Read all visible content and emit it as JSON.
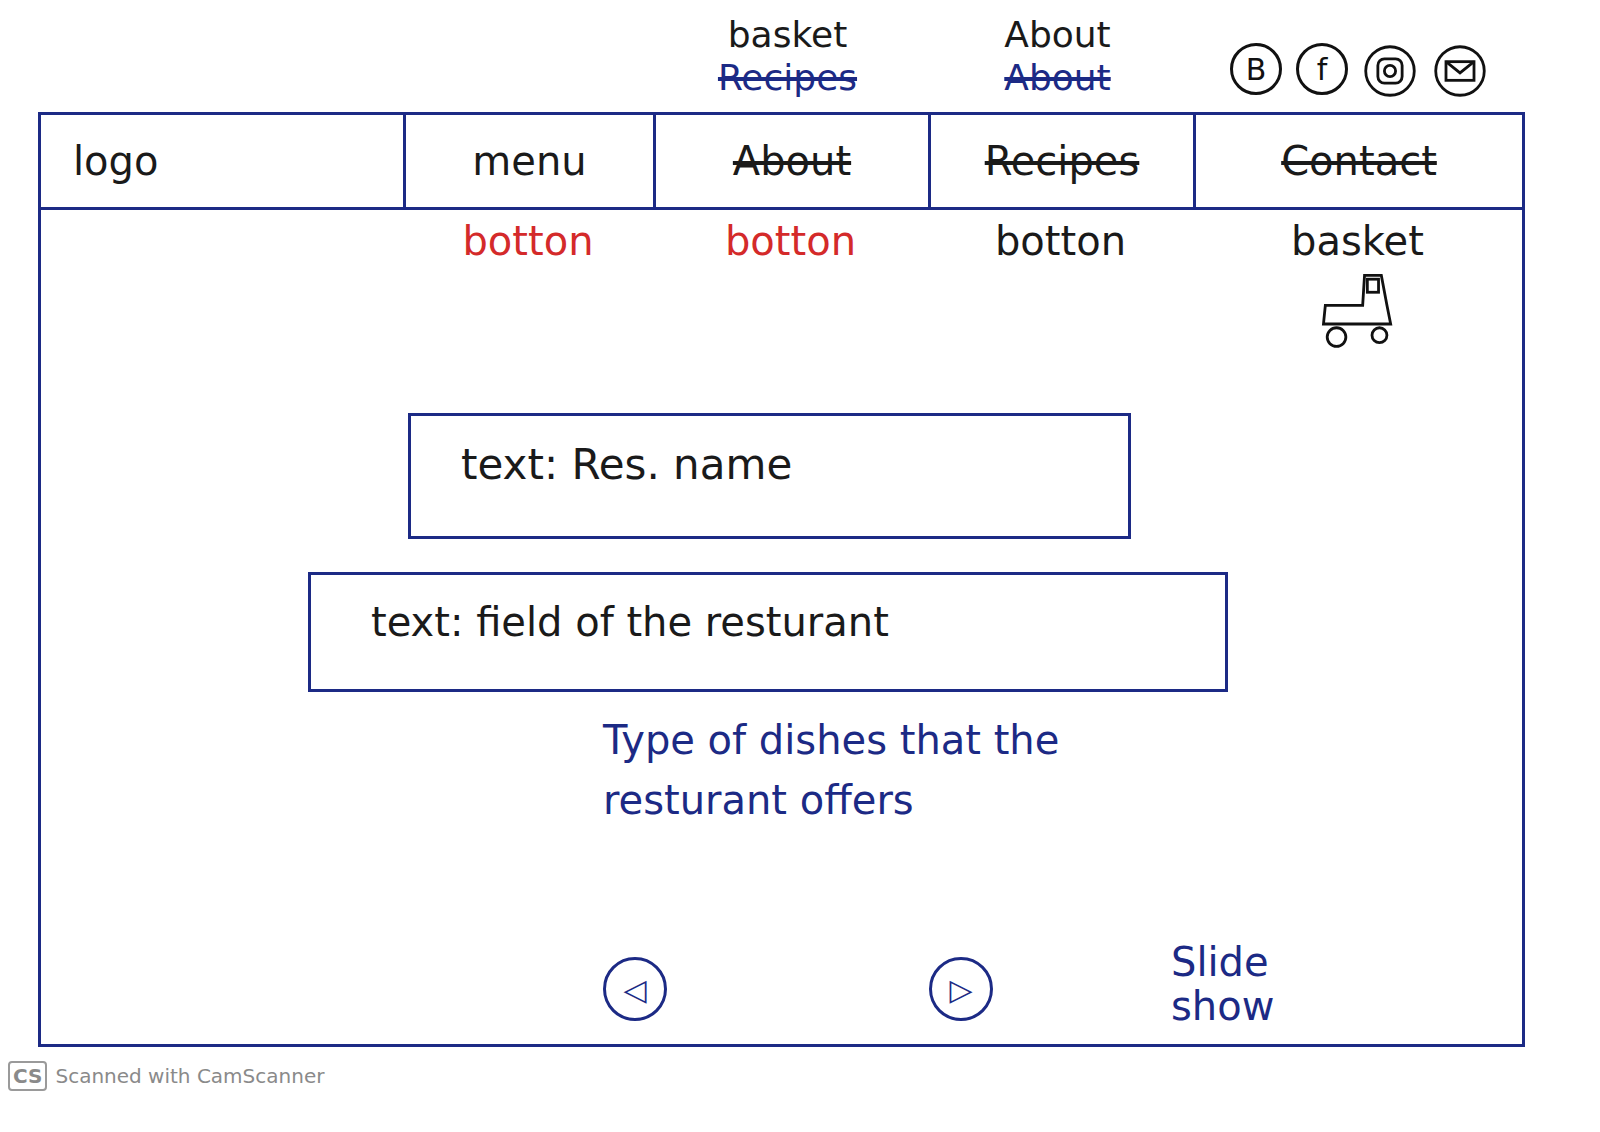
{
  "nav_annotations": [
    {
      "label": "basket",
      "replaced": "Recipes"
    },
    {
      "label": "About",
      "replaced": "About"
    }
  ],
  "social_icons": [
    {
      "kind": "letter",
      "glyph": "B"
    },
    {
      "kind": "letter",
      "glyph": "f"
    },
    {
      "kind": "camera"
    },
    {
      "kind": "mail"
    }
  ],
  "nav": {
    "items": [
      {
        "label": "logo",
        "struck": false
      },
      {
        "label": "menu",
        "struck": false
      },
      {
        "label": "About",
        "struck": true
      },
      {
        "label": "Recipes",
        "struck": true
      },
      {
        "label": "Contact",
        "struck": true
      }
    ]
  },
  "buttons": [
    {
      "label": "botton",
      "kind": "button",
      "color": "#d42a2a"
    },
    {
      "label": "botton",
      "kind": "button",
      "color": "#d42a2a"
    },
    {
      "label": "botton",
      "kind": "button",
      "color": "#1a1a1a"
    },
    {
      "label": "basket",
      "kind": "basket",
      "color": "#1a1a1a"
    }
  ],
  "name_box": "text: Res. name",
  "field_box": "text: field of the resturant",
  "description": [
    "Type of dishes that the",
    "resturant offers"
  ],
  "slideshow": {
    "prev": "◁",
    "next": "▷",
    "label": [
      "Slide",
      "show"
    ]
  },
  "footer": {
    "badge": "CS",
    "text": "Scanned with CamScanner"
  }
}
